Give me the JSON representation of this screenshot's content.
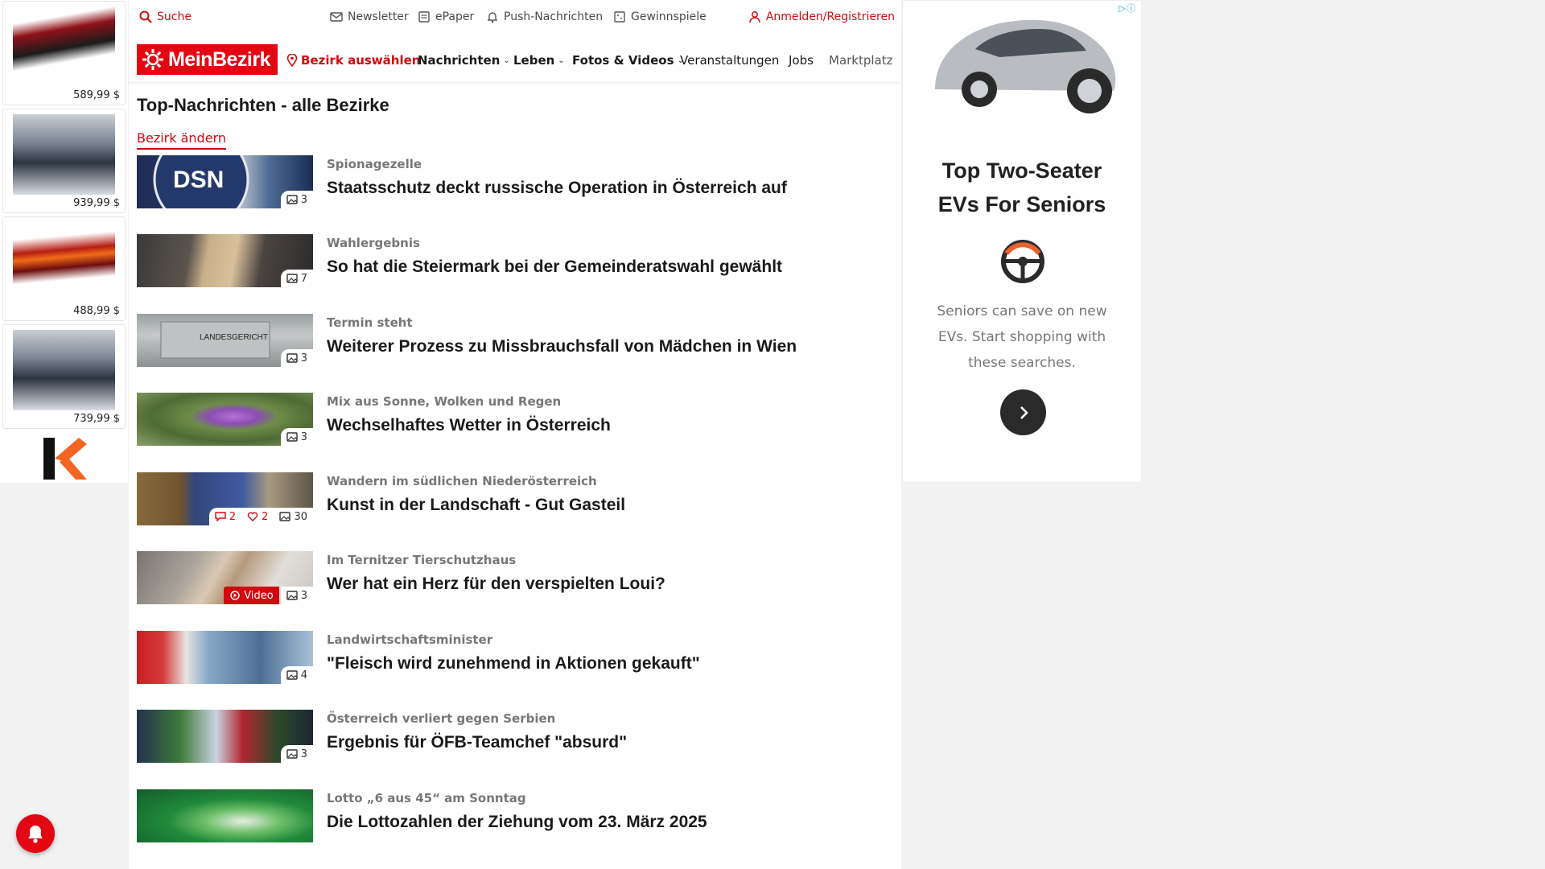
{
  "left_ad": {
    "adchoices": "▷ⓘ",
    "items": [
      {
        "price": "589,99 $"
      },
      {
        "price": "939,99 $"
      },
      {
        "price": "488,99 $"
      },
      {
        "price": "739,99 $"
      }
    ]
  },
  "topbar": {
    "search": "Suche",
    "newsletter": "Newsletter",
    "epaper": "ePaper",
    "push": "Push-Nachrichten",
    "games": "Gewinnspiele",
    "login": "Anmelden/Registrieren"
  },
  "nav": {
    "logo": "MeinBezirk",
    "select_district": "Bezirk auswählen",
    "news": "Nachrichten",
    "life": "Leben",
    "photos": "Fotos & Videos",
    "events": "Veranstaltungen",
    "jobs": "Jobs",
    "market": "Marktplatz"
  },
  "page": {
    "title": "Top-Nachrichten - alle Bezirke",
    "change_district": "Bezirk ändern"
  },
  "articles": [
    {
      "kicker": "Spionagezelle",
      "headline": "Staatsschutz deckt russische Operation in Österreich auf",
      "photos": "3",
      "thumb_label": "DSN"
    },
    {
      "kicker": "Wahlergebnis",
      "headline": "So hat die Steiermark bei der Gemeinderatswahl gewählt",
      "photos": "7"
    },
    {
      "kicker": "Termin steht",
      "headline": "Weiterer Prozess zu Missbrauchsfall von Mädchen in Wien",
      "photos": "3",
      "thumb_label": "LANDESGERICHT"
    },
    {
      "kicker": "Mix aus Sonne, Wolken und Regen",
      "headline": "Wechselhaftes Wetter in Österreich",
      "photos": "3"
    },
    {
      "kicker": "Wandern im südlichen Niederösterreich",
      "headline": "Kunst in der Landschaft - Gut Gasteil",
      "photos": "30",
      "comments": "2",
      "likes": "2"
    },
    {
      "kicker": "Im Ternitzer Tierschutzhaus",
      "headline": "Wer hat ein Herz für den verspielten Loui?",
      "photos": "3",
      "video": "Video"
    },
    {
      "kicker": "Landwirtschaftsminister",
      "headline": "\"Fleisch wird zunehmend in Aktionen gekauft\"",
      "photos": "4"
    },
    {
      "kicker": "Österreich verliert gegen Serbien",
      "headline": "Ergebnis für ÖFB-Teamchef \"absurd\"",
      "photos": "3"
    },
    {
      "kicker": "Lotto „6 aus 45“ am Sonntag",
      "headline": "Die Lottozahlen der Ziehung vom 23. März 2025"
    }
  ],
  "right_ad": {
    "adchoices": "▷ⓘ",
    "title_line1": "Top Two-Seater",
    "title_line2": "EVs For Seniors",
    "body": "Seniors can save on new EVs. Start shopping with these searches."
  },
  "colors": {
    "brand_red": "#e30613",
    "link_red": "#d10a10"
  }
}
